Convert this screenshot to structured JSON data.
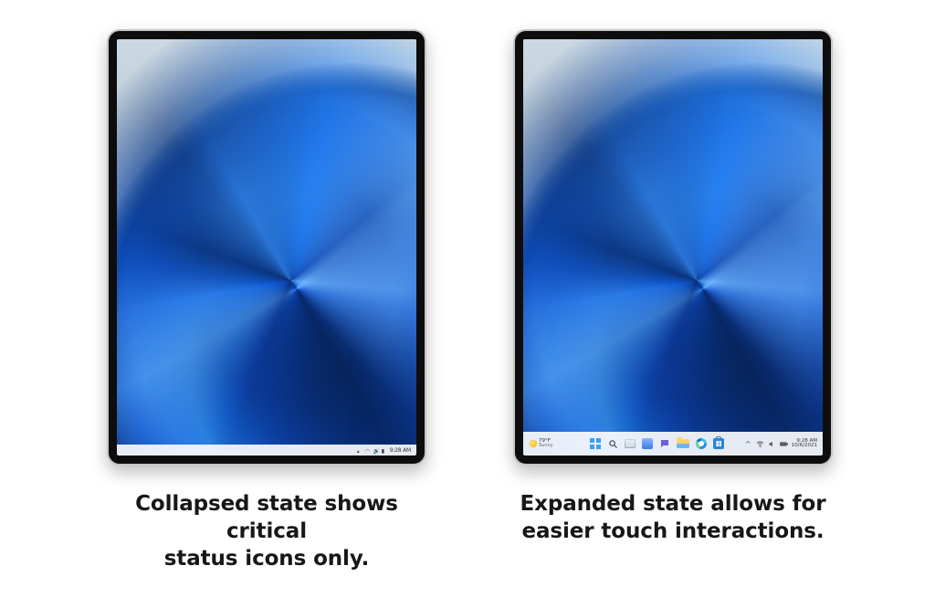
{
  "captions": {
    "collapsed_l1": "Collapsed state shows critical",
    "collapsed_l2": "status icons only.",
    "expanded_l1": "Expanded state allows for",
    "expanded_l2": "easier touch interactions."
  },
  "collapsed_taskbar": {
    "time": "9:28 AM"
  },
  "expanded_taskbar": {
    "weather_temp": "79°F",
    "weather_desc": "Sunny",
    "time": "9:28 AM",
    "date": "10/6/2021"
  }
}
